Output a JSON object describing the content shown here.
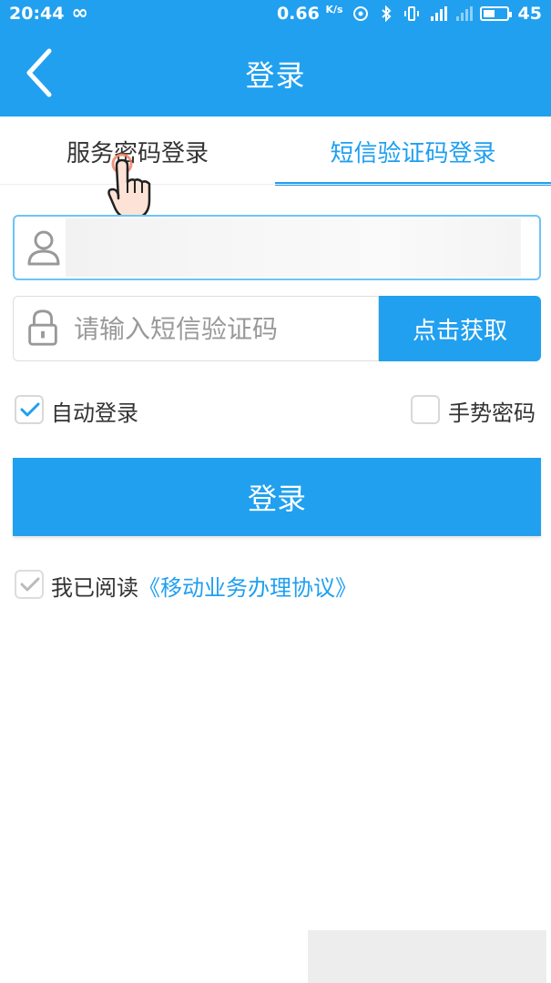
{
  "status_bar": {
    "time": "20:44",
    "network_speed": "0.66",
    "speed_unit": "K/s",
    "battery_level": "45"
  },
  "header": {
    "title": "登录"
  },
  "tabs": [
    {
      "label": "服务密码登录",
      "active": false
    },
    {
      "label": "短信验证码登录",
      "active": true
    }
  ],
  "form": {
    "phone_value": "",
    "code_placeholder": "请输入短信验证码",
    "get_code_label": "点击获取",
    "auto_login_label": "自动登录",
    "auto_login_checked": true,
    "gesture_password_label": "手势密码",
    "gesture_password_checked": false,
    "login_label": "登录",
    "agreement_prefix": "我已阅读",
    "agreement_link": "《移动业务办理协议》",
    "agreement_checked": true
  },
  "colors": {
    "accent": "#21a0f0",
    "text": "#333333",
    "placeholder": "#999999"
  },
  "icons": [
    "back-arrow-icon",
    "user-icon",
    "lock-icon",
    "checkmark-icon",
    "hand-pointer-icon"
  ]
}
